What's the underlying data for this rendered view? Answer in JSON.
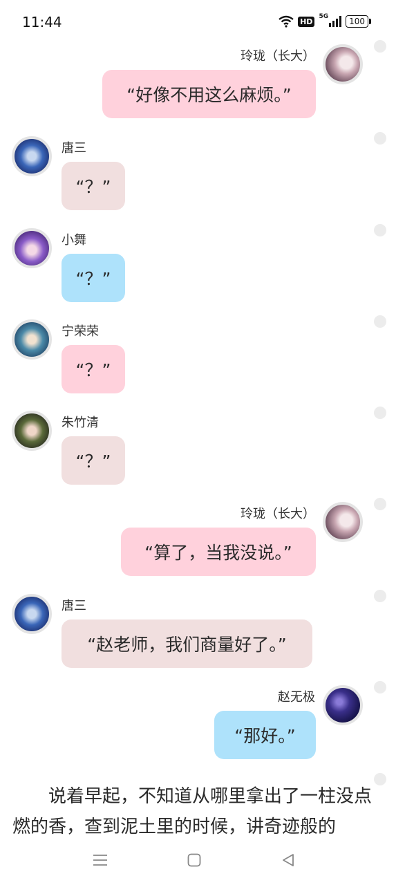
{
  "status_bar": {
    "time": "11:44",
    "network": "5G",
    "hd": "HD",
    "battery": "100"
  },
  "colors": {
    "pink": "#ffd1dc",
    "beige": "#f1dfdf",
    "blue": "#aee2fb",
    "dot": "#ececec"
  },
  "messages": [
    {
      "name": "玲珑（长大）",
      "text": "“好像不用这么麻烦。”",
      "side": "right",
      "bubble_color": "pink",
      "avatar_icon": "white-hair-girl-avatar"
    },
    {
      "name": "唐三",
      "text": "“？”",
      "side": "left",
      "bubble_color": "beige",
      "avatar_icon": "blue-hair-boy-avatar"
    },
    {
      "name": "小舞",
      "text": "“？”",
      "side": "left",
      "bubble_color": "blue",
      "avatar_icon": "purple-hair-girl-avatar"
    },
    {
      "name": "宁荣荣",
      "text": "“？”",
      "side": "left",
      "bubble_color": "pink",
      "avatar_icon": "teal-dress-girl-avatar"
    },
    {
      "name": "朱竹清",
      "text": "“？”",
      "side": "left",
      "bubble_color": "beige",
      "avatar_icon": "dark-hair-girl-avatar"
    },
    {
      "name": "玲珑（长大）",
      "text": "“算了，当我没说。”",
      "side": "right",
      "bubble_color": "pink",
      "avatar_icon": "white-hair-girl-avatar"
    },
    {
      "name": "唐三",
      "text": "“赵老师，我们商量好了。”",
      "side": "left",
      "bubble_color": "beige",
      "avatar_icon": "blue-hair-boy-avatar"
    },
    {
      "name": "赵无极",
      "text": "“那好。”",
      "side": "right",
      "bubble_color": "blue",
      "avatar_icon": "starry-sky-avatar"
    }
  ],
  "narrative": "说着早起，不知道从哪里拿出了一柱没点燃的香，查到泥土里的时候，讲奇迹般的",
  "nav": {
    "menu_icon": "menu-icon",
    "home_icon": "home-icon",
    "back_icon": "back-icon"
  }
}
